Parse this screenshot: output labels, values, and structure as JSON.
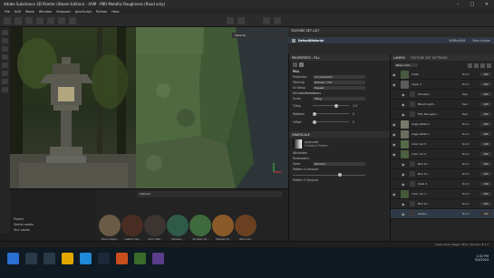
{
  "window": {
    "title": "Adobe Substance 3D Painter (Steam Edition) - ASM - PBR Metallic Roughness (Read only)",
    "controls": [
      "–",
      "□",
      "✕"
    ]
  },
  "menu": [
    "File",
    "Edit",
    "Mode",
    "Window",
    "Viewport",
    "JavaScript",
    "Python",
    "Help"
  ],
  "texture_set_list": {
    "header": "TEXTURE SET LIST",
    "item": "DefaultMaterial",
    "resolution": "4096x4096",
    "shader": "Main shader"
  },
  "viewport": {
    "material_dropdown": "Material"
  },
  "properties": {
    "header": "PROPERTIES - FILL",
    "fill_label": "FILL",
    "projection": {
      "label": "Projection",
      "value": "UV projection"
    },
    "filtering": {
      "label": "Filtering",
      "value": "Bilinear | HQ"
    },
    "uv_wrap": {
      "label": "UV Wrap",
      "value": "Repeat"
    },
    "uv_transformations": "UV transformations",
    "scale": {
      "label": "Scale",
      "value": "Tiling"
    },
    "tiling": {
      "label": "Tiling",
      "value": "1.5"
    },
    "rotation": {
      "label": "Rotation",
      "value": "0"
    },
    "offset": {
      "label": "Offset",
      "value": "0"
    },
    "grayscale_header": "GRAYSCALE",
    "grayscale_name": "grayscale",
    "grayscale_sub": "Gradient Pattern",
    "attributes": "Attributes",
    "parameters": "Parameters",
    "seed": {
      "label": "Seed",
      "value": "Random"
    },
    "pattern_x": "Pattern X Amount",
    "pattern_y": "Pattern Y Amount"
  },
  "layers": {
    "tab1": "LAYERS",
    "tab2": "TEXTURE SET SETTINGS",
    "blend_mode": "Base color",
    "items": [
      {
        "name": "mask",
        "blend": "Norm",
        "opacity": "100",
        "sub": false
      },
      {
        "name": "Layer 1",
        "blend": "Norm",
        "opacity": "100",
        "sub": false
      },
      {
        "name": "Sharpen",
        "blend": "Repl",
        "opacity": "100",
        "sub": true
      },
      {
        "name": "Blend Light...",
        "blend": "Repl",
        "opacity": "100",
        "sub": true
      },
      {
        "name": "HSL Perceptu...",
        "blend": "Repl",
        "opacity": "100",
        "sub": true
      },
      {
        "name": "edge detail 2",
        "blend": "Norm",
        "opacity": "100",
        "sub": false
      },
      {
        "name": "edge detail 1",
        "blend": "Norm",
        "opacity": "100",
        "sub": false
      },
      {
        "name": "color var 3",
        "blend": "Norm",
        "opacity": "100",
        "sub": false
      },
      {
        "name": "color var 2",
        "blend": "Norm",
        "opacity": "100",
        "sub": false
      },
      {
        "name": "Blur Sl...",
        "blend": "Norm",
        "opacity": "100",
        "sub": true
      },
      {
        "name": "Blur Sl...",
        "blend": "Norm",
        "opacity": "100",
        "sub": true
      },
      {
        "name": "Cells 4",
        "blend": "Norm",
        "opacity": "100",
        "sub": true
      },
      {
        "name": "color var 1",
        "blend": "Norm",
        "opacity": "100",
        "sub": false
      },
      {
        "name": "Blur Sl...",
        "blend": "Norm",
        "opacity": "100",
        "sub": true
      },
      {
        "name": "Grade...",
        "blend": "Norm",
        "opacity": "100",
        "sub": true
      }
    ]
  },
  "shelf": {
    "left_items": [
      "Project",
      "Starter assets",
      "Your assets"
    ],
    "search": "stylized",
    "materials": [
      {
        "name": "Stone Stylis...",
        "color": "#6b5a45"
      },
      {
        "name": "Leather Sty...",
        "color": "#4a2d22"
      },
      {
        "name": "Shiri Histi...",
        "color": "#3b3430"
      },
      {
        "name": "Stylized_...",
        "color": "#2f5a48"
      },
      {
        "name": "Stylized_Gr...",
        "color": "#3e6a3d"
      },
      {
        "name": "Stylized_B...",
        "color": "#8a5a2a"
      },
      {
        "name": "Wood Ch...",
        "color": "#6a4020"
      }
    ]
  },
  "status": {
    "text": "Cache Disk Usage: 93% | Version: 8.2.1"
  },
  "taskbar": {
    "time": "1:32 PM",
    "date": "5/3/2024"
  },
  "accent": "#2e7cd6"
}
